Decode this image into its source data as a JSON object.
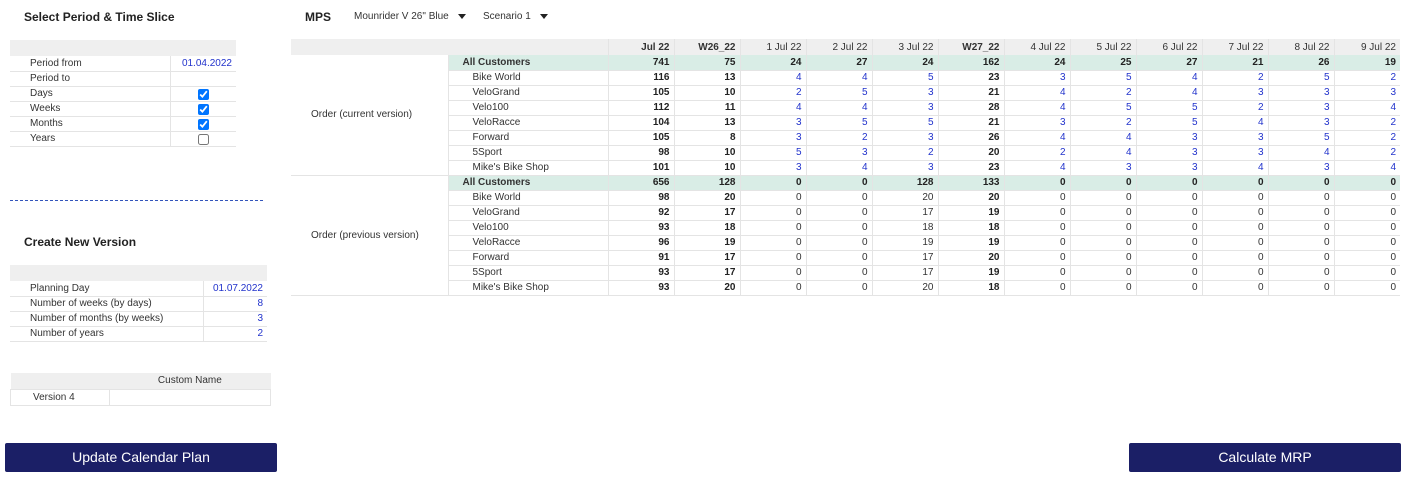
{
  "left": {
    "period_title": "Select Period & Time Slice",
    "period_rows": [
      {
        "label": "Period from",
        "value": "01.04.2022"
      },
      {
        "label": "Period to",
        "value": ""
      }
    ],
    "slice_rows": [
      {
        "label": "Days",
        "checked": true
      },
      {
        "label": "Weeks",
        "checked": true
      },
      {
        "label": "Months",
        "checked": true
      },
      {
        "label": "Years",
        "checked": false
      }
    ],
    "create_title": "Create New Version",
    "version_rows": [
      {
        "label": "Planning Day",
        "value": "01.07.2022"
      },
      {
        "label": "Number of weeks (by days)",
        "value": "8"
      },
      {
        "label": "Number of months (by weeks)",
        "value": "3"
      },
      {
        "label": "Number of years",
        "value": "2"
      }
    ],
    "custom_header": "Custom Name",
    "custom_version": "Version 4",
    "custom_name_value": "",
    "update_button": "Update Calendar Plan"
  },
  "mps": {
    "title": "MPS",
    "product_select": "Mounrider V 26\" Blue",
    "scenario_select": "Scenario 1",
    "calculate_button": "Calculate MRP",
    "columns": [
      {
        "label": "Jul 22",
        "bold": true
      },
      {
        "label": "W26_22",
        "bold": true
      },
      {
        "label": "1 Jul 22",
        "bold": false
      },
      {
        "label": "2 Jul 22",
        "bold": false
      },
      {
        "label": "3 Jul 22",
        "bold": false
      },
      {
        "label": "W27_22",
        "bold": true
      },
      {
        "label": "4 Jul 22",
        "bold": false
      },
      {
        "label": "5 Jul 22",
        "bold": false
      },
      {
        "label": "6 Jul 22",
        "bold": false
      },
      {
        "label": "7 Jul 22",
        "bold": false
      },
      {
        "label": "8 Jul 22",
        "bold": false
      },
      {
        "label": "9 Jul 22",
        "bold": false
      }
    ],
    "groups": [
      {
        "label": "Order (current version)",
        "editable": true,
        "rows": [
          {
            "customer": "All Customers",
            "total": true,
            "values": [
              "741",
              "75",
              "24",
              "27",
              "24",
              "162",
              "24",
              "25",
              "27",
              "21",
              "26",
              "19"
            ]
          },
          {
            "customer": "Bike World",
            "values": [
              "116",
              "13",
              "4",
              "4",
              "5",
              "23",
              "3",
              "5",
              "4",
              "2",
              "5",
              "2"
            ]
          },
          {
            "customer": "VeloGrand",
            "values": [
              "105",
              "10",
              "2",
              "5",
              "3",
              "21",
              "4",
              "2",
              "4",
              "3",
              "3",
              "3"
            ]
          },
          {
            "customer": "Velo100",
            "values": [
              "112",
              "11",
              "4",
              "4",
              "3",
              "28",
              "4",
              "5",
              "5",
              "2",
              "3",
              "4"
            ]
          },
          {
            "customer": "VeloRacce",
            "values": [
              "104",
              "13",
              "3",
              "5",
              "5",
              "21",
              "3",
              "2",
              "5",
              "4",
              "3",
              "2"
            ]
          },
          {
            "customer": "Forward",
            "values": [
              "105",
              "8",
              "3",
              "2",
              "3",
              "26",
              "4",
              "4",
              "3",
              "3",
              "5",
              "2"
            ]
          },
          {
            "customer": "5Sport",
            "values": [
              "98",
              "10",
              "5",
              "3",
              "2",
              "20",
              "2",
              "4",
              "3",
              "3",
              "4",
              "2"
            ]
          },
          {
            "customer": "Mike's Bike Shop",
            "values": [
              "101",
              "10",
              "3",
              "4",
              "3",
              "23",
              "4",
              "3",
              "3",
              "4",
              "3",
              "4"
            ]
          }
        ]
      },
      {
        "label": "Order (previous version)",
        "editable": false,
        "rows": [
          {
            "customer": "All Customers",
            "total": true,
            "values": [
              "656",
              "128",
              "0",
              "0",
              "128",
              "133",
              "0",
              "0",
              "0",
              "0",
              "0",
              "0"
            ]
          },
          {
            "customer": "Bike World",
            "values": [
              "98",
              "20",
              "0",
              "0",
              "20",
              "20",
              "0",
              "0",
              "0",
              "0",
              "0",
              "0"
            ]
          },
          {
            "customer": "VeloGrand",
            "values": [
              "92",
              "17",
              "0",
              "0",
              "17",
              "19",
              "0",
              "0",
              "0",
              "0",
              "0",
              "0"
            ]
          },
          {
            "customer": "Velo100",
            "values": [
              "93",
              "18",
              "0",
              "0",
              "18",
              "18",
              "0",
              "0",
              "0",
              "0",
              "0",
              "0"
            ]
          },
          {
            "customer": "VeloRacce",
            "values": [
              "96",
              "19",
              "0",
              "0",
              "19",
              "19",
              "0",
              "0",
              "0",
              "0",
              "0",
              "0"
            ]
          },
          {
            "customer": "Forward",
            "values": [
              "91",
              "17",
              "0",
              "0",
              "17",
              "20",
              "0",
              "0",
              "0",
              "0",
              "0",
              "0"
            ]
          },
          {
            "customer": "5Sport",
            "values": [
              "93",
              "17",
              "0",
              "0",
              "17",
              "19",
              "0",
              "0",
              "0",
              "0",
              "0",
              "0"
            ]
          },
          {
            "customer": "Mike's Bike Shop",
            "values": [
              "93",
              "20",
              "0",
              "0",
              "20",
              "18",
              "0",
              "0",
              "0",
              "0",
              "0",
              "0"
            ]
          }
        ]
      }
    ]
  },
  "colors": {
    "button_bg": "#1b1f66",
    "input_blue": "#2233cc",
    "total_row_bg": "#d9ede6",
    "header_bg": "#efefef"
  }
}
